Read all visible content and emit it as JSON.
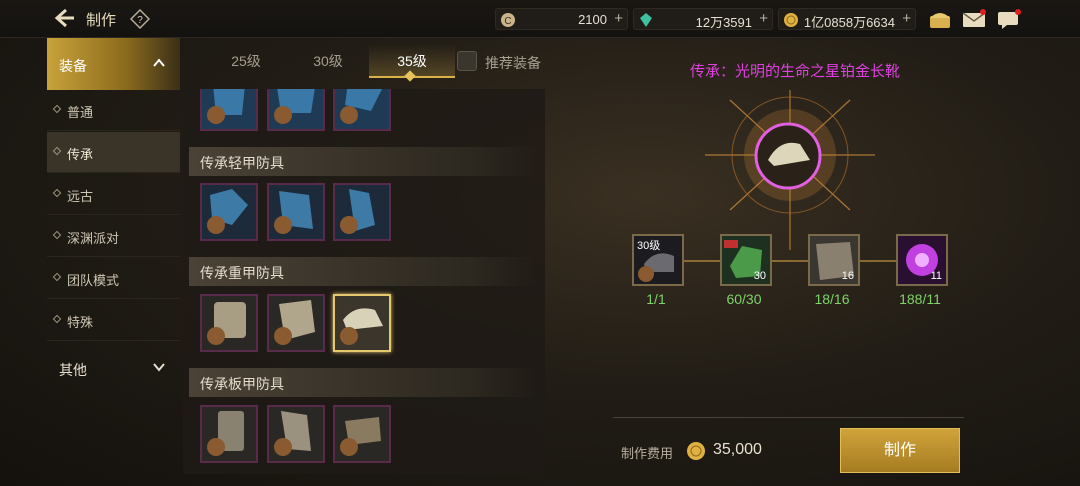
{
  "header": {
    "title": "制作",
    "help": "?"
  },
  "resources": [
    {
      "icon": "coin-c-icon",
      "value": "2100"
    },
    {
      "icon": "green-gem-icon",
      "value": "12万3591"
    },
    {
      "icon": "gold-coin-icon",
      "value": "1亿0858万6634"
    }
  ],
  "top_icons": [
    "treasure-chest-icon",
    "mail-icon",
    "chat-icon"
  ],
  "menu": {
    "category_equip": "装备",
    "subs": [
      "普通",
      "传承",
      "远古",
      "深渊派对",
      "团队模式",
      "特殊"
    ],
    "category_other": "其他"
  },
  "tabs": [
    "25级",
    "30级",
    "35级"
  ],
  "recommended_label": "推荐装备",
  "sections": [
    "传承轻甲防具",
    "传承重甲防具",
    "传承板甲防具"
  ],
  "detail": {
    "title": "传承：光明的生命之星铂金长靴",
    "materials": [
      {
        "label": "30级",
        "count": "",
        "qty": "1/1"
      },
      {
        "label": "",
        "count": "30",
        "qty": "60/30"
      },
      {
        "label": "",
        "count": "16",
        "qty": "18/16"
      },
      {
        "label": "",
        "count": "11",
        "qty": "188/11"
      }
    ],
    "cost_label": "制作费用",
    "cost_value": "35,000",
    "craft_button": "制作"
  },
  "colors": {
    "accent": "#d9b24a",
    "item_name": "#e040e0",
    "qty_ok": "#7fd36a",
    "rare_border": "#5a2a4a"
  }
}
